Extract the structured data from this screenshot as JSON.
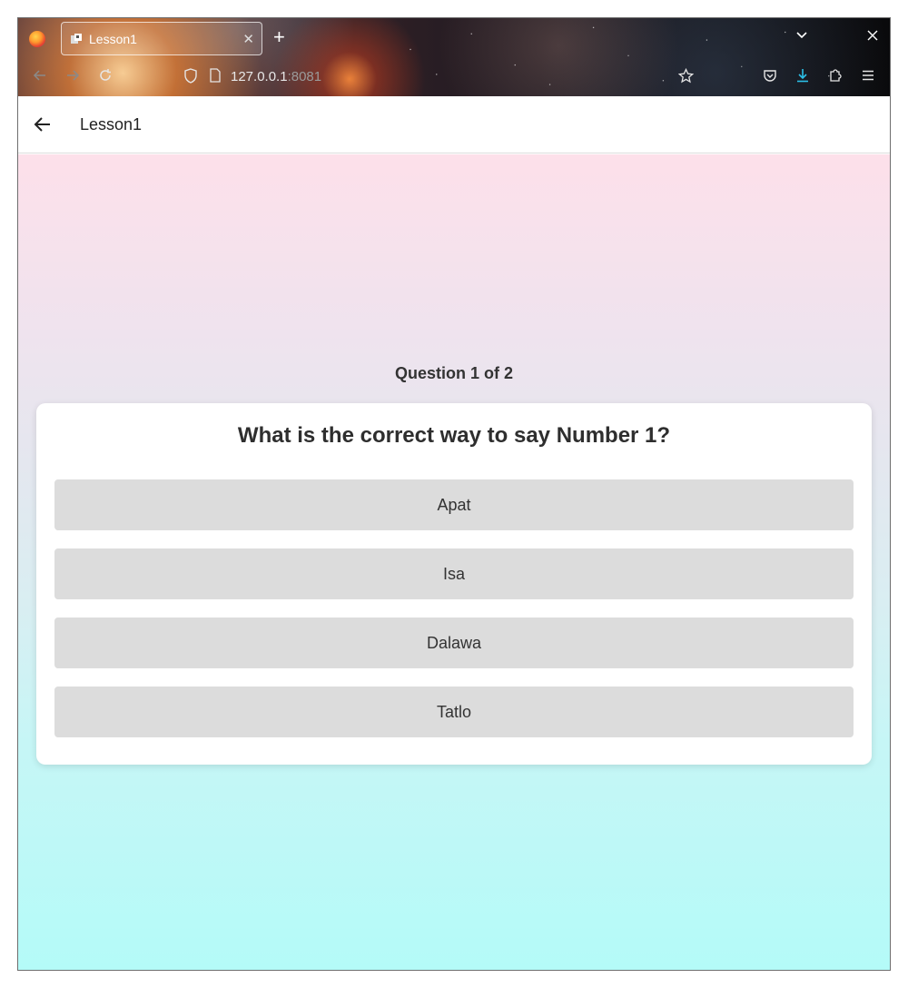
{
  "browser": {
    "tab_title": "Lesson1",
    "url_host": "127.0.0.1",
    "url_port": ":8081"
  },
  "app": {
    "title": "Lesson1"
  },
  "quiz": {
    "progress": "Question 1 of 2",
    "question": "What is the correct way to say Number 1?",
    "options": [
      "Apat",
      "Isa",
      "Dalawa",
      "Tatlo"
    ]
  },
  "icons": {
    "back": "arrow-left-icon",
    "reload": "reload-icon",
    "bookmark": "star-icon",
    "pocket": "pocket-icon",
    "downloads": "download-icon",
    "extensions": "puzzle-icon",
    "menu": "hamburger-menu-icon"
  },
  "colors": {
    "option_bg": "#dcdcdc",
    "card_bg": "#ffffff",
    "download_accent": "#2bc0e8"
  }
}
